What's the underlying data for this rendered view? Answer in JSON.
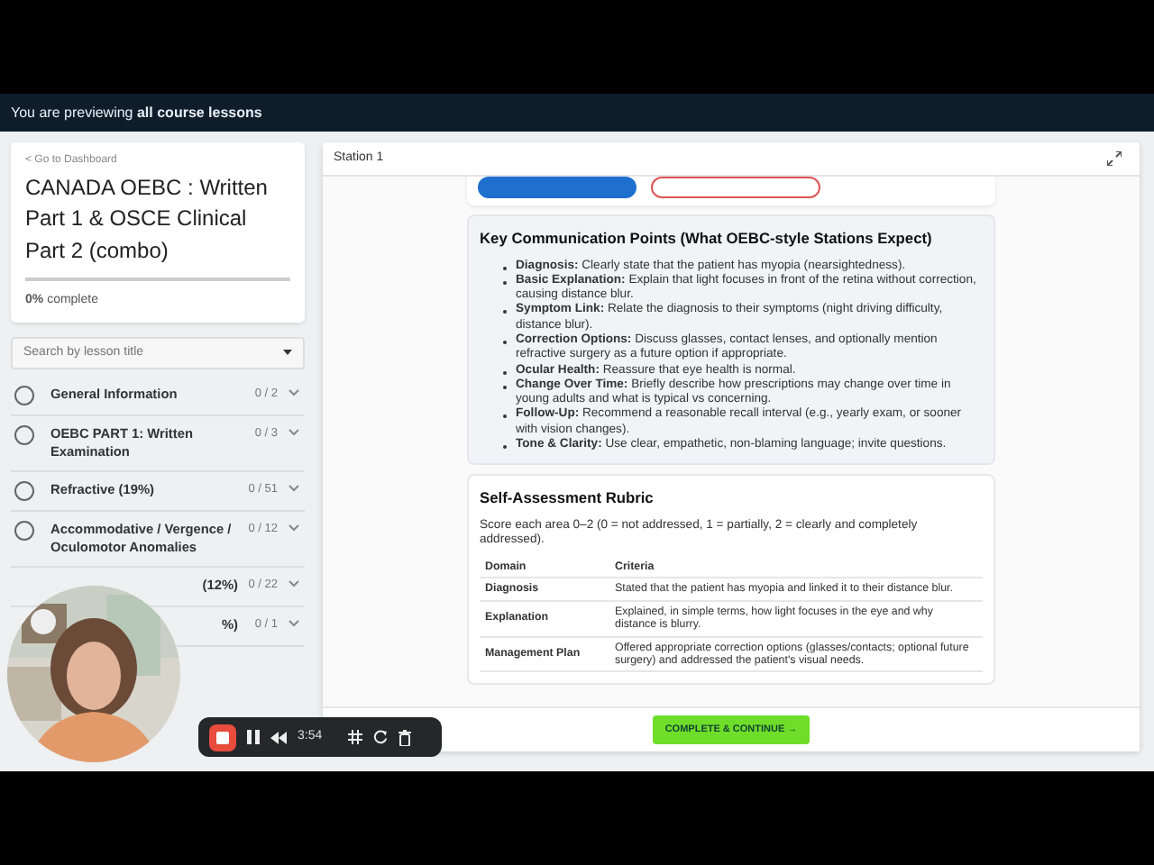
{
  "banner": {
    "text": "You are previewing",
    "emphasis": "all course lessons"
  },
  "sidebar": {
    "back_link": "< Go to Dashboard",
    "course_title": "CANADA OEBC : Written Part 1 & OSCE Clinical Part 2 (combo)",
    "progress": {
      "text": "**0%** complete",
      "level": 0
    },
    "search": {
      "placeholder": "Search by lesson title"
    },
    "lessons": [
      {
        "title": "General Information",
        "count": "0 / 2",
        "completed": false,
        "covered": false
      },
      {
        "title": "OEBC PART 1: Written Examination",
        "count": "0 / 3",
        "completed": false,
        "covered": false
      },
      {
        "title": "Refractive (19%)",
        "count": "0 / 51",
        "completed": false,
        "covered": false
      },
      {
        "title": "Accommodative / Vergence / Oculomotor Anomalies",
        "count": "0 / 12",
        "completed": false,
        "covered": false
      },
      {
        "title": "(12%)",
        "count": "0 / 22",
        "covered": true
      },
      {
        "title": "%)",
        "count": "0 / 1",
        "covered": true
      }
    ]
  },
  "player": {
    "title": "Station 1",
    "top_buttons": [
      {
        "kind": "filled"
      },
      {
        "kind": "outline"
      }
    ],
    "key_points": {
      "heading": "Key Communication Points (What OEBC-style Stations Expect)",
      "items": [
        {
          "term": "Diagnosis:",
          "text": "Clearly state that the patient has myopia (nearsightedness)."
        },
        {
          "term": "Basic Explanation:",
          "text": "Explain that light focuses in front of the retina without correction, causing distance blur."
        },
        {
          "term": "Symptom Link:",
          "text": "Relate the diagnosis to their symptoms (night driving difficulty, distance blur)."
        },
        {
          "term": "Correction Options:",
          "text": "Discuss glasses, contact lenses, and optionally mention refractive surgery as a future option if appropriate."
        },
        {
          "term": "Ocular Health:",
          "text": "Reassure that eye health is normal."
        },
        {
          "term": "Change Over Time:",
          "text": "Briefly describe how prescriptions may change over time in young adults and what is typical vs concerning."
        },
        {
          "term": "Follow-Up:",
          "text": "Recommend a reasonable recall interval (e.g., yearly exam, or sooner with vision changes)."
        },
        {
          "term": "Tone & Clarity:",
          "text": "Use clear, empathetic, non-blaming language; invite questions."
        }
      ]
    },
    "rubric": {
      "heading": "Self-Assessment Rubric",
      "intro": "Score each area 0–2 (0 = not addressed, 1 = partially, 2 = clearly and completely addressed).",
      "columns": [
        "Domain",
        "Criteria"
      ],
      "rows": [
        [
          "Diagnosis",
          "Stated that the patient has myopia and linked it to their distance blur."
        ],
        [
          "Explanation",
          "Explained, in simple terms, how light focuses in the eye and why distance is blurry."
        ],
        [
          "Management Plan",
          "Offered appropriate correction options (glasses/contacts; optional future surgery) and addressed the patient's visual needs."
        ]
      ]
    },
    "complete_button": "COMPLETE & CONTINUE →"
  },
  "recorder": {
    "time": "3:54"
  }
}
